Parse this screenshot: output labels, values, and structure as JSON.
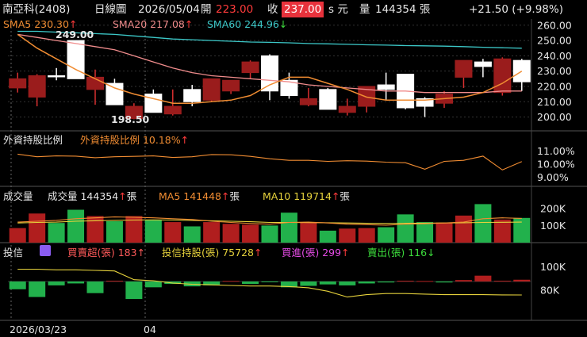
{
  "header": {
    "stock": "南亞科(2408)",
    "chart_name": "日線圖",
    "date": "2026/05/04",
    "open_label": "開",
    "open_value": "223.00",
    "close_label": "收",
    "close_value": "237.00",
    "unit": "s 元",
    "volume_label": "量",
    "volume_value": "144354 張",
    "change": "+21.50 (+9.98%)"
  },
  "colors": {
    "up": "#b01e1e",
    "down": "#22b14c",
    "bg": "#000000",
    "sma5": "#f08c32",
    "sma20": "#f08c8c",
    "sma60": "#3cc8c8",
    "ma5vol": "#f08c32",
    "ma10vol": "#e6d23c"
  },
  "price_panel": {
    "sma5_label": "SMA5 230.30",
    "sma20_label": "SMA20 217.08",
    "sma60_label": "SMA60 244.96",
    "high_label": "249.00",
    "low_label": "198.50"
  },
  "foreign_panel": {
    "title": "外資持股比例",
    "legend": "外資持股比例 10.18%"
  },
  "volume_panel": {
    "title": "成交量",
    "vol_legend": "成交量 144354",
    "ma5_legend": "MA5 141448",
    "ma10_legend": "MA10 119714",
    "unit": "張"
  },
  "trust_panel": {
    "title": "投信",
    "buy_sell_legend": "買賣超(張) 183",
    "holding_legend": "投信持股(張) 75728",
    "buy_legend": "買進(張) 299",
    "sell_legend": "賣出(張) 116"
  },
  "x_axis": {
    "labels": [
      "2026/03/23",
      "04"
    ]
  },
  "chart_data": [
    {
      "type": "candlestick",
      "y_ticks": [
        200,
        210,
        220,
        230,
        240,
        250,
        260
      ],
      "ylim": [
        192,
        263
      ],
      "open": [
        225,
        227,
        227,
        225,
        226,
        208,
        207,
        203,
        207,
        210,
        225,
        224,
        236,
        217,
        214,
        212,
        205,
        207,
        220,
        218,
        206,
        207,
        215,
        237,
        233,
        238,
        223
      ],
      "close": [
        219,
        213,
        227,
        250,
        218,
        222,
        199,
        215,
        202,
        218,
        211,
        217,
        229,
        240,
        224,
        208,
        218,
        203,
        207,
        221,
        228,
        212,
        209,
        226,
        236,
        216,
        237
      ],
      "high": [
        229,
        228,
        232,
        250,
        231,
        225,
        209,
        218,
        218,
        221,
        225,
        224,
        237,
        241,
        229,
        219,
        219,
        212,
        215,
        229,
        228,
        213,
        217,
        237,
        238,
        239,
        238
      ],
      "low": [
        216,
        207,
        224,
        225,
        208,
        208,
        198.5,
        207,
        201,
        207,
        210,
        215,
        225,
        211,
        212,
        207,
        207,
        201,
        203,
        211,
        205,
        200,
        206,
        219,
        226,
        214,
        217
      ],
      "sma5": [
        254,
        245,
        238,
        231,
        225,
        219,
        215,
        212,
        209,
        209,
        210,
        211,
        214,
        221,
        226,
        226,
        222,
        218,
        213,
        211,
        211,
        211,
        212,
        213,
        216,
        222,
        230
      ],
      "sma20": [
        254,
        252,
        250,
        248,
        246,
        244,
        240,
        236,
        232,
        229,
        227,
        226,
        225,
        224,
        223,
        221,
        220,
        219,
        218,
        217,
        217,
        216,
        216,
        216,
        216,
        217,
        217
      ],
      "sma60": [
        256,
        256,
        255.5,
        255,
        254.5,
        254,
        253,
        252,
        251,
        250.5,
        250,
        249.5,
        249,
        248.8,
        248.5,
        248,
        247.8,
        247.5,
        247.2,
        247,
        246.7,
        246.5,
        246.3,
        246,
        245.6,
        245.3,
        244.96
      ]
    },
    {
      "type": "line",
      "y_ticks": [
        "9.00%",
        "10.00%",
        "11.00%"
      ],
      "ylim": [
        8.6,
        11.5
      ],
      "values": [
        10.75,
        10.55,
        10.62,
        10.6,
        10.48,
        10.55,
        10.58,
        10.62,
        10.5,
        10.55,
        10.72,
        10.7,
        10.58,
        10.4,
        10.28,
        10.28,
        10.2,
        10.25,
        10.22,
        10.14,
        10.1,
        9.6,
        10.2,
        10.28,
        10.6,
        9.55,
        10.18
      ]
    },
    {
      "type": "bar",
      "y_ticks": [
        "100K",
        "200K"
      ],
      "ylim": [
        0,
        250000
      ],
      "values": [
        85000,
        170000,
        115000,
        192000,
        155000,
        125000,
        155000,
        132000,
        120000,
        95000,
        120000,
        110000,
        105000,
        100000,
        175000,
        120000,
        70000,
        82000,
        85000,
        90000,
        165000,
        120000,
        118000,
        158000,
        225000,
        135000,
        144354
      ],
      "ma5": [
        120000,
        125000,
        130000,
        140000,
        145000,
        150000,
        148000,
        145000,
        140000,
        135000,
        125000,
        118000,
        112000,
        108000,
        118000,
        120000,
        115000,
        108000,
        105000,
        102000,
        108000,
        110000,
        115000,
        120000,
        140000,
        145000,
        141448
      ],
      "ma10": [
        115000,
        118000,
        120000,
        125000,
        128000,
        130000,
        132000,
        133000,
        132000,
        130000,
        128000,
        125000,
        122000,
        118000,
        118000,
        117000,
        116000,
        115000,
        113000,
        112000,
        113000,
        114000,
        115000,
        116000,
        118000,
        119000,
        119714
      ]
    },
    {
      "type": "bar",
      "y_ticks": [
        "80K",
        "100K"
      ],
      "values": [
        -800,
        -1600,
        -400,
        -200,
        -1200,
        80,
        -1800,
        -600,
        -250,
        -500,
        -400,
        60,
        -250,
        -50,
        -600,
        -450,
        -300,
        -400,
        -200,
        -100,
        80,
        50,
        -100,
        150,
        600,
        80,
        183
      ],
      "holding": [
        98000,
        98000,
        97500,
        97500,
        97000,
        96500,
        89000,
        88000,
        86000,
        85000,
        84500,
        84000,
        83500,
        83500,
        83000,
        82000,
        79000,
        74000,
        76000,
        77000,
        77000,
        76500,
        76000,
        76000,
        76000,
        75800,
        75728
      ],
      "holding_ylim": [
        60000,
        110000
      ]
    }
  ]
}
